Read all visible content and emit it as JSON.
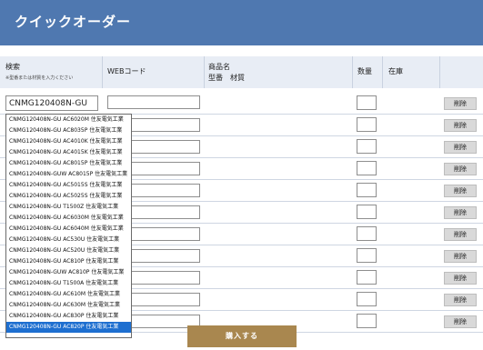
{
  "header": {
    "title": "クイックオーダー"
  },
  "columns": {
    "search": "検索",
    "search_note": "※型番または材質を入力ください",
    "web_code": "WEBコード",
    "product_name": "商品名",
    "model_material": "型番　材質",
    "quantity": "数量",
    "stock": "在庫"
  },
  "search": {
    "value": "CNMG120408N-GU"
  },
  "delete_label": "削除",
  "suggestions": [
    "CNMG120408N-GU AC6020M 住友電気工業",
    "CNMG120408N-GU AC8035P 住友電気工業",
    "CNMG120408N-GU AC4010K 住友電気工業",
    "CNMG120408N-GU AC4015K 住友電気工業",
    "CNMG120408N-GU AC8015P 住友電気工業",
    "CNMG120408N-GUW AC8015P 住友電気工業",
    "CNMG120408N-GU AC5015S 住友電気工業",
    "CNMG120408N-GU AC5025S 住友電気工業",
    "CNMG120408N-GU T1500Z 住友電気工業",
    "CNMG120408N-GU AC6030M 住友電気工業",
    "CNMG120408N-GU AC6040M 住友電気工業",
    "CNMG120408N-GU AC530U 住友電気工業",
    "CNMG120408N-GU AC520U 住友電気工業",
    "CNMG120408N-GU AC810P 住友電気工業",
    "CNMG120408N-GUW AC810P 住友電気工業",
    "CNMG120408N-GU T1500A 住友電気工業",
    "CNMG120408N-GU AC610M 住友電気工業",
    "CNMG120408N-GU AC630M 住友電気工業",
    "CNMG120408N-GU AC830P 住友電気工業",
    "CNMG120408N-GU AC820P 住友電気工業"
  ],
  "selected_suggestion": 19,
  "buy_button": {
    "label": "購入する"
  }
}
